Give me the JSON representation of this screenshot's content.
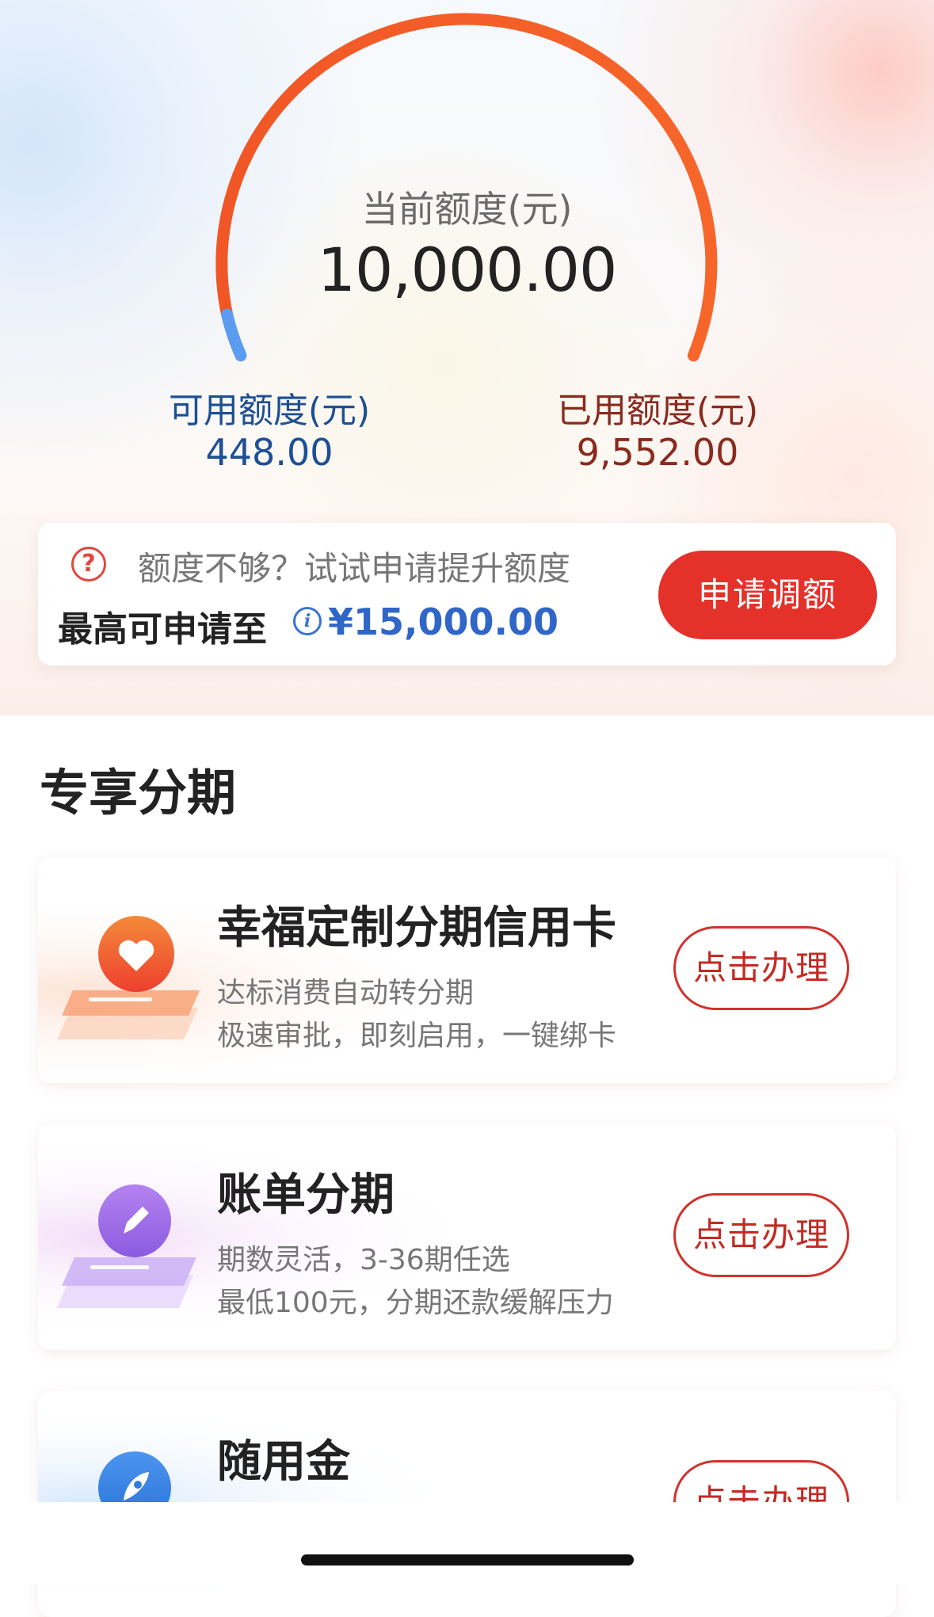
{
  "credit": {
    "current_label": "当前额度(元)",
    "current_value": "10,000.00",
    "available_label": "可用额度(元)",
    "available_value": "448.00",
    "used_label": "已用额度(元)",
    "used_value": "9,552.00",
    "used_ratio": 0.9552
  },
  "promo": {
    "hint": "额度不够？试试申请提升额度",
    "max_label": "最高可申请至",
    "max_value": "¥15,000.00",
    "apply_button": "申请调额"
  },
  "section": {
    "title": "专享分期"
  },
  "cards": [
    {
      "title": "幸福定制分期信用卡",
      "line1": "达标消费自动转分期",
      "line2": "极速审批，即刻启用，一键绑卡",
      "button": "点击办理",
      "icon": "heart-icon",
      "accent": "#f0622e"
    },
    {
      "title": "账单分期",
      "line1": "期数灵活，3-36期任选",
      "line2": "最低100元，分期还款缓解压力",
      "button": "点击办理",
      "icon": "pencil-icon",
      "accent": "#9b6be6"
    },
    {
      "title": "随用金",
      "button": "点击办理",
      "icon": "rocket-icon",
      "accent": "#2f7de0"
    }
  ],
  "colors": {
    "gauge_used": "#f25b25",
    "gauge_available": "#5b9cf0",
    "primary_red": "#e4312a",
    "available_text": "#1d4f94",
    "used_text": "#8a2a1d"
  }
}
